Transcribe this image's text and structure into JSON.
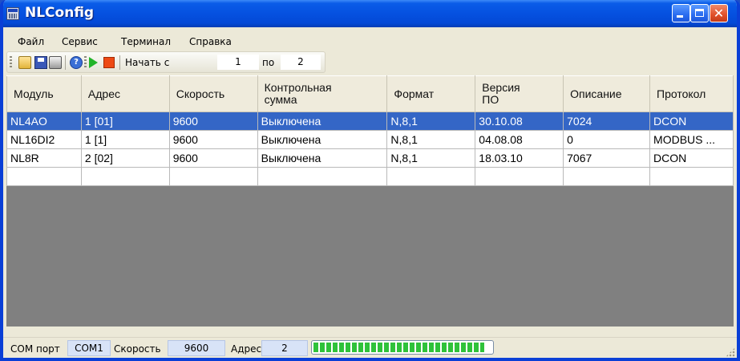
{
  "window": {
    "title": "NLConfig"
  },
  "menu": {
    "items": [
      "Файл",
      "Сервис",
      "Терминал",
      "Справка"
    ]
  },
  "toolbar": {
    "start_label": "Начать с",
    "start_value": "1",
    "to_label": "по",
    "to_value": "2"
  },
  "table": {
    "columns": [
      "Модуль",
      "Адрес",
      "Скорость",
      "Контрольная\nсумма",
      "Формат",
      "Версия\nПО",
      "Описание",
      "Протокол"
    ],
    "rows": [
      {
        "cells": [
          "NL4AO",
          "1 [01]",
          "9600",
          "Выключена",
          "N,8,1",
          "30.10.08",
          "7024",
          "DCON"
        ],
        "selected": true
      },
      {
        "cells": [
          "NL16DI2",
          "1 [1]",
          "9600",
          "Выключена",
          "N,8,1",
          "04.08.08",
          "0",
          "MODBUS ..."
        ],
        "selected": false
      },
      {
        "cells": [
          "NL8R",
          "2 [02]",
          "9600",
          "Выключена",
          "N,8,1",
          "18.03.10",
          "7067",
          "DCON"
        ],
        "selected": false
      },
      {
        "cells": [
          "",
          "",
          "",
          "",
          "",
          "",
          "",
          ""
        ],
        "selected": false
      }
    ]
  },
  "status": {
    "port_label": "COM порт",
    "port_value": "COM1",
    "speed_label": "Скорость",
    "speed_value": "9600",
    "address_label": "Адрес",
    "address_value": "2",
    "progress": 0.96
  },
  "colors": {
    "selection": "#3466c6",
    "titlebar": "#0551e0",
    "grid_bg": "#808080"
  }
}
